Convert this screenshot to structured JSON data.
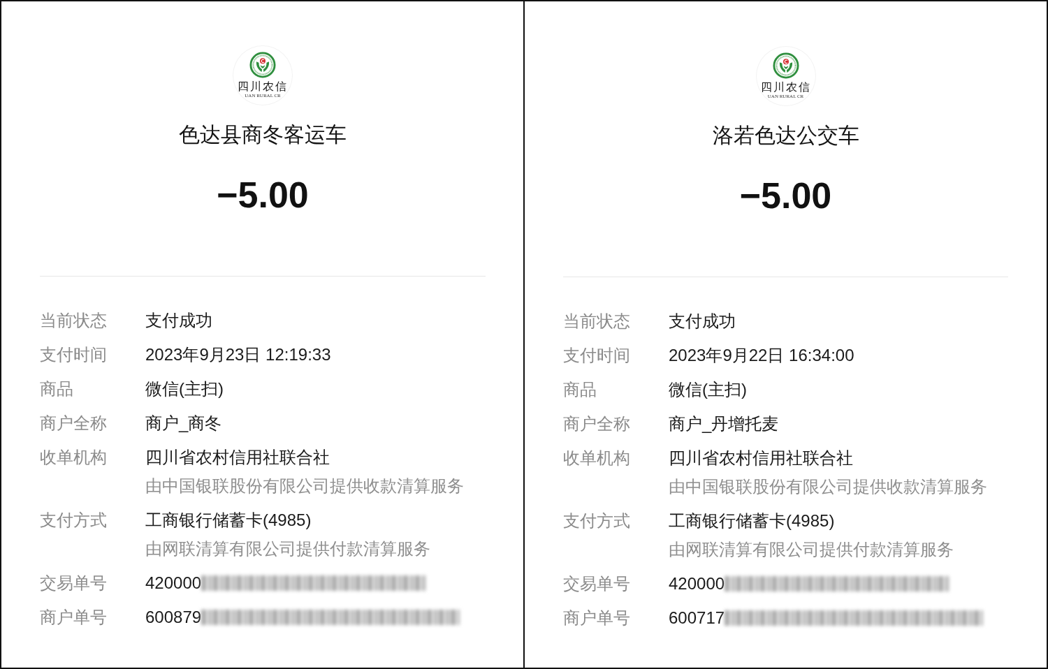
{
  "receipts": [
    {
      "logo": {
        "text": "四川农信",
        "subtext": "UAN RURAL CR"
      },
      "merchant_title": "色达县商冬客运车",
      "amount": "−5.00",
      "details": [
        {
          "label": "当前状态",
          "value": "支付成功",
          "blurred": false
        },
        {
          "label": "支付时间",
          "value": "2023年9月23日 12:19:33",
          "blurred": false
        },
        {
          "label": "商品",
          "value": "微信(主扫)",
          "blurred": false
        },
        {
          "label": "商户全称",
          "value": "商户_商冬",
          "blurred": false
        },
        {
          "label": "收单机构",
          "value": "四川省农村信用社联合社",
          "note": "由中国银联股份有限公司提供收款清算服务",
          "blurred": false
        },
        {
          "label": "支付方式",
          "value": "工商银行储蓄卡(4985)",
          "note": "由网联清算有限公司提供付款清算服务",
          "blurred": false
        },
        {
          "label": "交易单号",
          "value": "420000",
          "blurred": true
        },
        {
          "label": "商户单号",
          "value": "600879",
          "blurred": true
        }
      ]
    },
    {
      "logo": {
        "text": "四川农信",
        "subtext": "UAN RURAL CR"
      },
      "merchant_title": "洛若色达公交车",
      "amount": "−5.00",
      "details": [
        {
          "label": "当前状态",
          "value": "支付成功",
          "blurred": false
        },
        {
          "label": "支付时间",
          "value": "2023年9月22日 16:34:00",
          "blurred": false
        },
        {
          "label": "商品",
          "value": "微信(主扫)",
          "blurred": false
        },
        {
          "label": "商户全称",
          "value": "商户_丹增托麦",
          "blurred": false
        },
        {
          "label": "收单机构",
          "value": "四川省农村信用社联合社",
          "note": "由中国银联股份有限公司提供收款清算服务",
          "blurred": false
        },
        {
          "label": "支付方式",
          "value": "工商银行储蓄卡(4985)",
          "note": "由网联清算有限公司提供付款清算服务",
          "blurred": false
        },
        {
          "label": "交易单号",
          "value": "420000",
          "blurred": true
        },
        {
          "label": "商户单号",
          "value": "600717",
          "blurred": true
        }
      ]
    }
  ]
}
